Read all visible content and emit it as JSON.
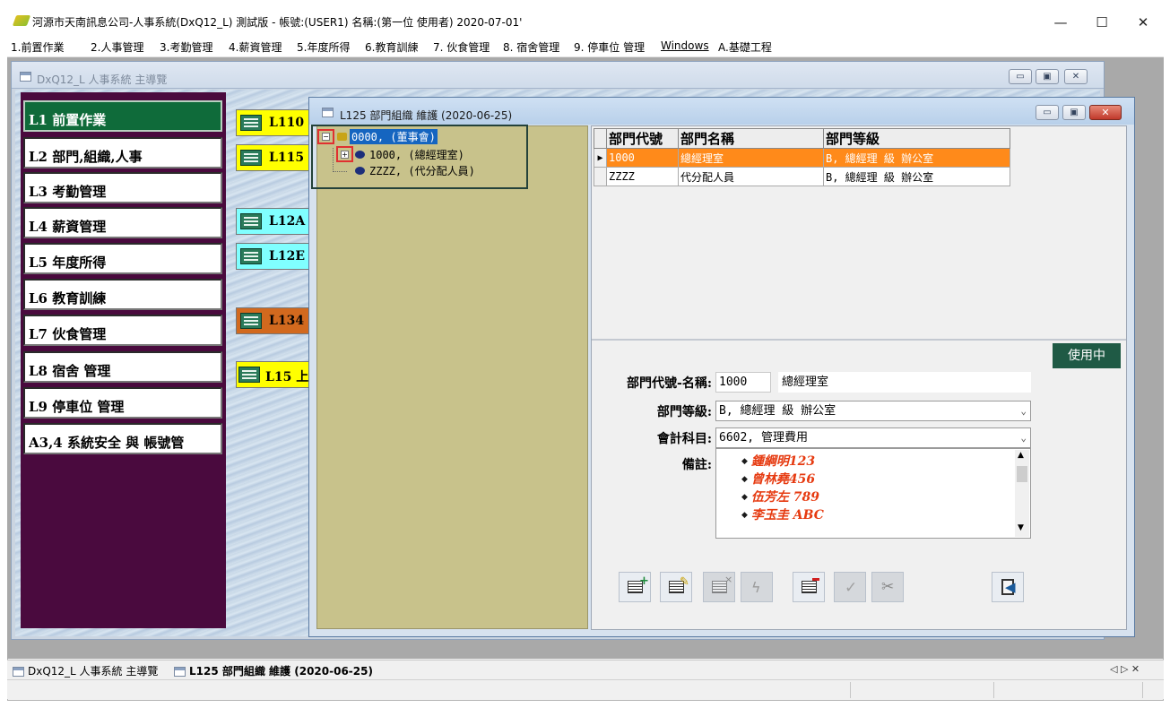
{
  "window": {
    "title": "河源市天南訊息公司-人事系統(DxQ12_L) 測試版 - 帳號:(USER1) 名稱:(第一位 使用者) 2020-07-01'",
    "minimize": "—",
    "maximize": "☐",
    "close": "✕"
  },
  "menu": [
    {
      "label": "1.前置作業"
    },
    {
      "label": "2.人事管理"
    },
    {
      "label": "3.考勤管理"
    },
    {
      "label": "4.薪資管理"
    },
    {
      "label": "5.年度所得"
    },
    {
      "label": "6.教育訓練"
    },
    {
      "label": "7. 伙食管理"
    },
    {
      "label": "8. 宿舍管理"
    },
    {
      "label": "9. 停車位 管理"
    },
    {
      "label": "Windows"
    },
    {
      "label": "A.基礎工程"
    }
  ],
  "main_child": {
    "title": "DxQ12_L 人事系統 主導覽",
    "nav": [
      {
        "label": "L1 前置作業"
      },
      {
        "label": "L2 部門,組織,人事"
      },
      {
        "label": "L3 考勤管理"
      },
      {
        "label": "L4 薪資管理"
      },
      {
        "label": "L5 年度所得"
      },
      {
        "label": "L6 教育訓練"
      },
      {
        "label": "L7 伙食管理"
      },
      {
        "label": "L8 宿舍 管理"
      },
      {
        "label": "L9 停車位 管理"
      },
      {
        "label": "A3,4 系統安全 與 帳號管"
      }
    ],
    "commands": [
      {
        "label": "L110",
        "color": "#ffff00"
      },
      {
        "label": "L115",
        "color": "#ffff00"
      },
      {
        "label": "L12A",
        "color": "#80ffff"
      },
      {
        "label": "L12E",
        "color": "#80ffff"
      },
      {
        "label": "L134",
        "color": "#d2691e"
      },
      {
        "label": "L15 上",
        "color": "#ffff00"
      }
    ]
  },
  "dept_child": {
    "title": "L125 部門組織 維護 (2020-06-25)",
    "tree": [
      {
        "label": "0000, (董事會)"
      },
      {
        "label": "1000, (總經理室)"
      },
      {
        "label": "ZZZZ, (代分配人員)"
      }
    ],
    "grid": {
      "columns": [
        "部門代號",
        "部門名稱",
        "部門等級"
      ],
      "rows": [
        {
          "code": "1000",
          "name": "總經理室",
          "level": "B, 總經理 級 辦公室"
        },
        {
          "code": "ZZZZ",
          "name": "代分配人員",
          "level": "B, 總經理 級 辦公室"
        }
      ]
    },
    "status_badge": "使用中",
    "form": {
      "code_name_label": "部門代號-名稱:",
      "code_value": "1000",
      "name_value": "總經理室",
      "level_label": "部門等級:",
      "level_value": "B, 總經理 級 辦公室",
      "account_label": "會計科目:",
      "account_value": "6602, 管理費用",
      "notes_label": "備註:",
      "notes": [
        "鍾綱明123",
        "曾林堯456",
        "伍芳左 789",
        "李玉圭 ABC"
      ]
    }
  },
  "taskbar": {
    "tab1": "DxQ12_L 人事系統 主導覽",
    "tab2": "L125 部門組織 維護 (2020-06-25)",
    "nav_arrows": "◁ ▷ ✕"
  }
}
